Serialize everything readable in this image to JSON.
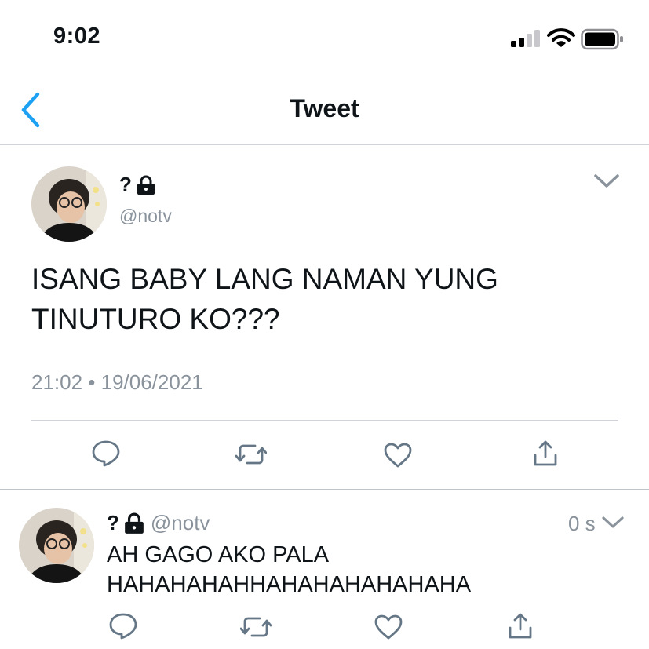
{
  "status_bar": {
    "time": "9:02"
  },
  "nav": {
    "title": "Tweet"
  },
  "main_tweet": {
    "name": "?",
    "handle": "@notv",
    "text_line1": "ISANG BABY LANG NAMAN YUNG",
    "text_line2": "TINUTURO KO???",
    "timestamp": "21:02 • 19/06/2021"
  },
  "reply": {
    "name": "?",
    "handle": "@notv",
    "time": "0 s",
    "text_line1": "AH GAGO AKO PALA",
    "text_line2": "HAHAHAHAHHAHAHAHAHAHAHA"
  },
  "colors": {
    "accent": "#1da1f2",
    "icon_gray": "#657786",
    "muted": "#8a939c",
    "divider": "#cfd3d7"
  }
}
